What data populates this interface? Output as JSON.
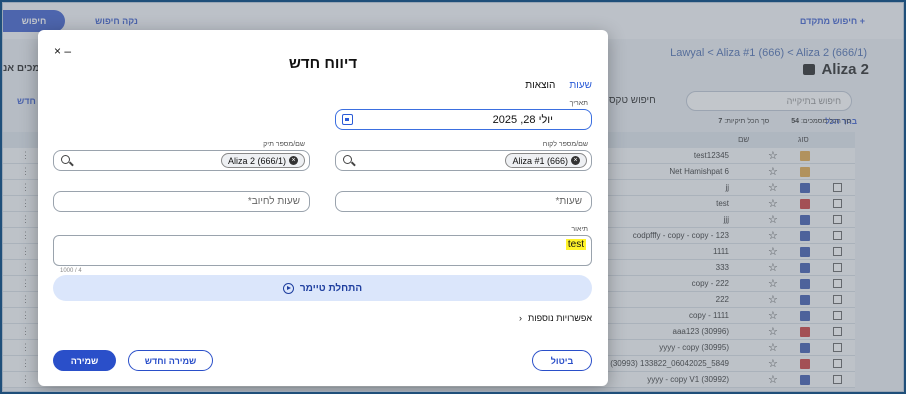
{
  "background": {
    "search_button_label": "חיפוש",
    "clear_search_label": "נקה חיפוש",
    "advanced_search_label": "חיפוש מתקדם +",
    "breadcrumb": "Lawyal < Aliza #1 (666) < Aliza 2 (666/1)",
    "matter_title": "Aliza 2",
    "side_label": "מכים אנ",
    "side_new_label": "חדש",
    "filter_placeholder": "חיפוש בתיקייה",
    "text_search_label": "חיפוש טקס",
    "stats": {
      "total_docs_label": "סך הכל מסמכים:",
      "total_docs_value": "54",
      "total_folders_label": "סך הכל תיקיות:",
      "total_folders_value": "7"
    },
    "select_all_label": "בחר הכל",
    "columns": {
      "type": "סוג",
      "name": "שם"
    },
    "rows": [
      {
        "name": "test12345",
        "kind": "folder"
      },
      {
        "name": "Net Hamishpat 6",
        "kind": "folder"
      },
      {
        "name": "jj",
        "kind": "word"
      },
      {
        "name": "test",
        "kind": "pdf"
      },
      {
        "name": "jjj",
        "kind": "word"
      },
      {
        "name": "codpfffy - copy - copy - 123",
        "kind": "word"
      },
      {
        "name": "1111",
        "kind": "word"
      },
      {
        "name": "333",
        "kind": "word"
      },
      {
        "name": "copy - 222",
        "kind": "word"
      },
      {
        "name": "222",
        "kind": "word"
      },
      {
        "name": "copy - 1111",
        "kind": "word"
      },
      {
        "name": "aaa123 (30996)",
        "kind": "pdf"
      },
      {
        "name": "yyyy - copy (30995)",
        "kind": "word"
      },
      {
        "name": "5849_06042025_133822 (30993)",
        "kind": "pdf"
      },
      {
        "name": "yyyy - copy V1 (30992)",
        "kind": "word"
      }
    ]
  },
  "modal": {
    "controls": "× –",
    "title": "דיווח חדש",
    "tabs": {
      "hours": "שעות",
      "expenses": "הוצאות"
    },
    "date_label": "תאריך",
    "date_value": "יולי 28, 2025",
    "client_label": "שם/מספר לקוח",
    "client_value": "Aliza #1 (666)",
    "case_label": "שם/מספר תיק",
    "case_value": "Aliza 2 (666/1)",
    "hours_placeholder": "שעות*",
    "billable_hours_placeholder": "שעות לחיוב*",
    "description_label": "תיאור",
    "description_value": "test",
    "char_counter": "1000 / 4",
    "timer_label": "התחלת טיימר",
    "more_options_label": "אפשרויות נוספות",
    "buttons": {
      "save": "שמירה",
      "save_new": "שמירה וחדש",
      "cancel": "ביטול"
    }
  },
  "colors": {
    "primary": "#2a4fc9",
    "highlight": "#fff32a",
    "timer_bg": "#dbe6fb"
  }
}
